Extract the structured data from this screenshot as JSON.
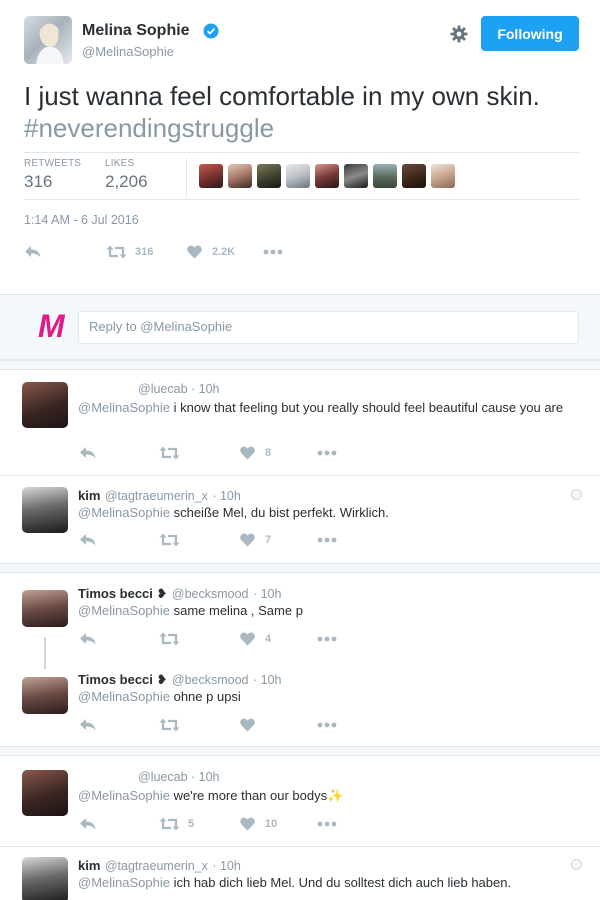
{
  "tweet": {
    "author_name": "Melina Sophie",
    "author_handle": "@MelinaSophie",
    "follow_label": "Following",
    "text": "I just wanna feel comfortable in my own skin.",
    "hashtag": "#neverendingstruggle",
    "retweets_label": "RETWEETS",
    "retweets_count": "316",
    "likes_label": "LIKES",
    "likes_count": "2,206",
    "timestamp": "1:14 AM - 6 Jul 2016",
    "action_retweet_count": "316",
    "action_like_count": "2.2K"
  },
  "reply_box": {
    "logo": "M",
    "placeholder": "Reply to @MelinaSophie"
  },
  "replies": [
    {
      "name": "",
      "handle": "@luecab",
      "time": "· 10h",
      "mention": "@MelinaSophie",
      "text": " i know that feeling but you really should feel beautiful cause you are",
      "retweets": "",
      "likes": "8"
    },
    {
      "name": "kim",
      "handle": "@tagtraeumerin_x",
      "time": "· 10h",
      "mention": "@MelinaSophie",
      "text": " scheiße Mel, du bist perfekt. Wirklich.",
      "retweets": "",
      "likes": "7"
    },
    {
      "name": "Timos becci ❥",
      "handle": "@becksmood",
      "time": "· 10h",
      "mention": "@MelinaSophie",
      "text": " same melina , Same p",
      "retweets": "",
      "likes": "4"
    },
    {
      "name": "Timos becci ❥",
      "handle": "@becksmood",
      "time": "· 10h",
      "mention": "@MelinaSophie",
      "text": " ohne p upsi",
      "retweets": "",
      "likes": ""
    },
    {
      "name": "",
      "handle": "@luecab",
      "time": "· 10h",
      "mention": "@MelinaSophie",
      "text": " we're more than our bodys",
      "emoji": "✨",
      "retweets": "5",
      "likes": "10"
    },
    {
      "name": "kim",
      "handle": "@tagtraeumerin_x",
      "time": "· 10h",
      "mention": "@MelinaSophie",
      "text": " ich hab dich lieb Mel. Und du solltest dich auch lieb haben.",
      "retweets": "",
      "likes": ""
    }
  ],
  "icons": {
    "verified": "verified-badge-icon",
    "settings": "gear-icon",
    "reply": "reply-icon",
    "retweet": "retweet-icon",
    "like": "heart-icon",
    "more": "more-dots-icon",
    "globe": "globe-icon"
  },
  "colors": {
    "accent": "#1da1f2",
    "hashtag": "#8899a6",
    "logo": "#e0198c",
    "muted": "#aab8c2"
  }
}
